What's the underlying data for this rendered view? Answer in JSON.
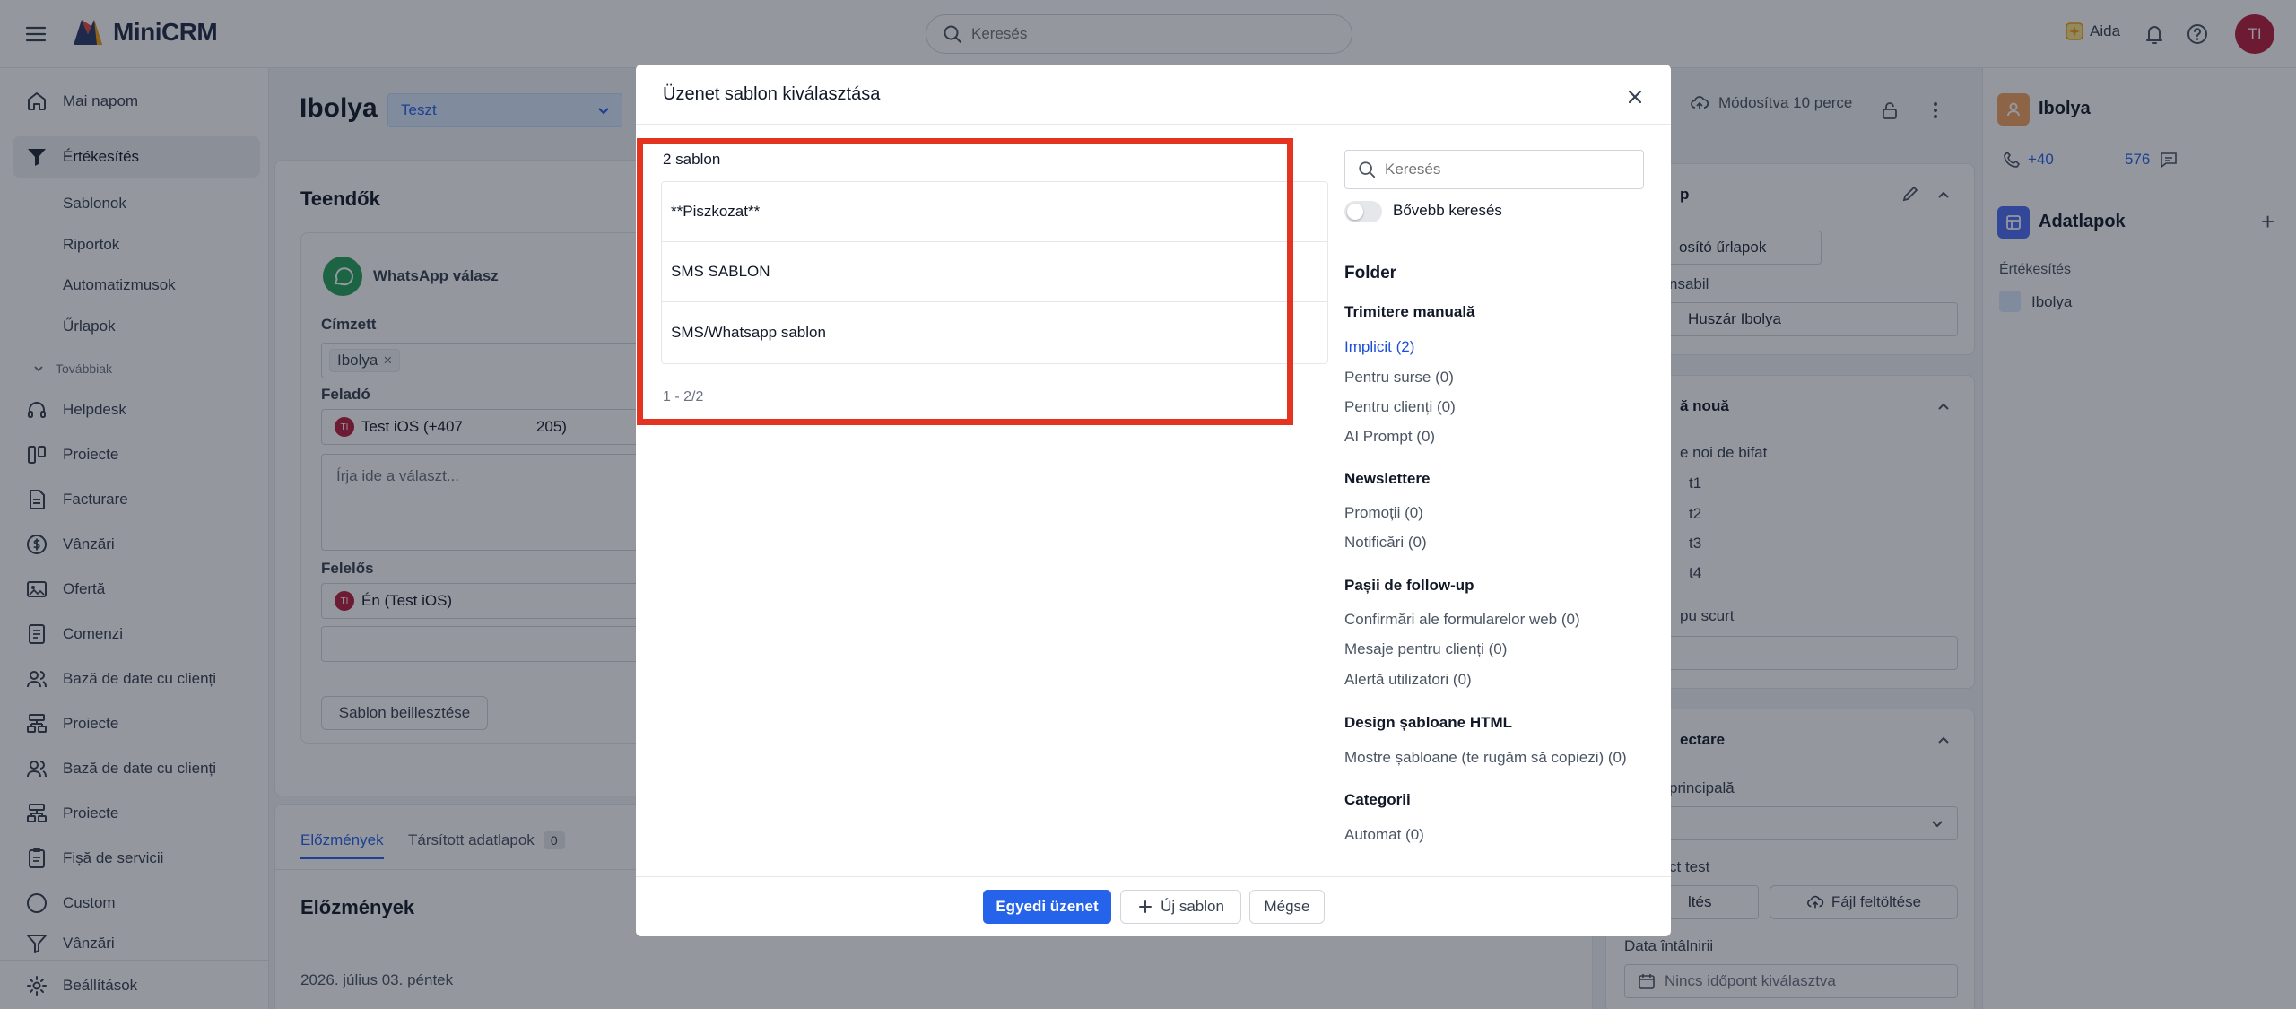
{
  "app": {
    "name": "MiniCRM"
  },
  "topbar": {
    "search_placeholder": "Keresés",
    "aida_label": "Aida",
    "avatar_initials": "TI"
  },
  "sidebar": {
    "items": [
      {
        "label": "Mai napom",
        "icon": "home-icon"
      },
      {
        "label": "Értékesítés",
        "icon": "filter-icon",
        "active": true
      },
      {
        "label": "Sablonok",
        "sub": true
      },
      {
        "label": "Riportok",
        "sub": true
      },
      {
        "label": "Automatizmusok",
        "sub": true
      },
      {
        "label": "Űrlapok",
        "sub": true
      },
      {
        "label": "Továbbiak",
        "section": true
      },
      {
        "label": "Helpdesk",
        "icon": "headset-icon"
      },
      {
        "label": "Proiecte",
        "icon": "board-icon"
      },
      {
        "label": "Facturare",
        "icon": "document-icon"
      },
      {
        "label": "Vânzări",
        "icon": "dollar-icon"
      },
      {
        "label": "Ofertă",
        "icon": "image-icon"
      },
      {
        "label": "Comenzi",
        "icon": "list-doc-icon"
      },
      {
        "label": "Bază de date cu clienți",
        "icon": "users-icon"
      },
      {
        "label": "Proiecte",
        "icon": "hierarchy-icon"
      },
      {
        "label": "Bază de date cu clienți",
        "icon": "users-icon"
      },
      {
        "label": "Proiecte",
        "icon": "hierarchy-icon"
      },
      {
        "label": "Fișă de servicii",
        "icon": "clipboard-icon"
      },
      {
        "label": "Custom",
        "icon": "circle-icon"
      },
      {
        "label": "Vânzări",
        "icon": "filter-icon"
      }
    ],
    "settings_label": "Beállítások"
  },
  "main": {
    "title": "Ibolya",
    "status_select": "Teszt",
    "todo_heading": "Teendők",
    "whatsapp_title": "WhatsApp válasz",
    "recipient_label": "Címzett",
    "recipient_chip": "Ibolya",
    "sender_label": "Feladó",
    "sender_value": "Test iOS (+407",
    "sender_suffix": "205)",
    "sender_initials": "TI",
    "reply_placeholder": "Írja ide a választ...",
    "owner_label": "Felelős",
    "owner_value": "Én (Test iOS)",
    "insert_template_btn": "Sablon beillesztése",
    "tab_history": "Előzmények",
    "tab_linked": "Társított adatlapok",
    "tab_linked_count": "0",
    "history_heading": "Előzmények",
    "history_date": "2026. július 03. péntek"
  },
  "right_area": {
    "modified": "Módosítva 10 perce",
    "card1_title_frag": "p",
    "form_select_frag": "osító űrlapok",
    "owner_label_frag": "nsabil",
    "owner_value_frag": "Huszár Ibolya",
    "card2_title_frag": "ă nouă",
    "check_label_frag": "e noi de bifat",
    "checks": [
      "t1",
      "t2",
      "t3",
      "t4"
    ],
    "short_label_frag": "pu scurt",
    "card3_title_frag": "ectare",
    "principal_frag": "principală",
    "test_label_frag": "ct test",
    "upload_select_frag": "ltés",
    "upload_btn": "Fájl feltöltése",
    "meeting_label": "Data întâlnirii",
    "meeting_value": "Nincs időpont kiválasztva"
  },
  "right_panel": {
    "contact_name": "Ibolya",
    "phone_start": "+40",
    "phone_end": "576",
    "adatlapok_title": "Adatlapok",
    "section_label": "Értékesítés",
    "item": "Ibolya"
  },
  "modal": {
    "title": "Üzenet sablon kiválasztása",
    "count_label": "2 sablon",
    "templates": [
      "**Piszkozat**",
      "SMS SABLON",
      "SMS/Whatsapp sablon"
    ],
    "pagination": "1 - 2/2",
    "search_placeholder": "Keresés",
    "extended_search_label": "Bővebb keresés",
    "folder_heading": "Folder",
    "groups": [
      {
        "title": "Trimitere manuală",
        "items": [
          "Implicit (2)",
          "Pentru surse (0)",
          "Pentru clienți (0)",
          "AI Prompt (0)"
        ]
      },
      {
        "title": "Newslettere",
        "items": [
          "Promoții (0)",
          "Notificări (0)"
        ]
      },
      {
        "title": "Pașii de follow-up",
        "items": [
          "Confirmări ale formularelor web (0)",
          "Mesaje pentru clienți (0)",
          "Alertă utilizatori (0)"
        ]
      },
      {
        "title": "Design șabloane HTML",
        "items": [
          "Mostre șabloane (te rugăm să copiezi) (0)"
        ]
      },
      {
        "title": "Categorii",
        "items": [
          "Automat (0)"
        ]
      }
    ],
    "footer": {
      "custom_btn": "Egyedi üzenet",
      "new_btn": "Új sablon",
      "cancel_btn": "Mégse"
    }
  },
  "colors": {
    "accent": "#2563eb",
    "highlight_box": "#e53322",
    "avatar": "#b91c3c"
  }
}
